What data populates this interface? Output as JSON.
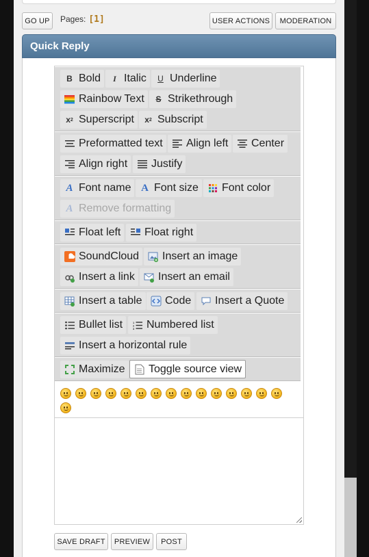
{
  "nav": {
    "go_up": "GO UP",
    "pages_label": "Pages:",
    "pages_value": "[1]",
    "user_actions": "USER ACTIONS",
    "moderation": "MODERATION"
  },
  "quick_reply": {
    "title": "Quick Reply"
  },
  "toolbar": {
    "bold": "Bold",
    "italic": "Italic",
    "underline": "Underline",
    "rainbow": "Rainbow Text",
    "strike": "Strikethrough",
    "superscript": "Superscript",
    "subscript": "Subscript",
    "preformatted": "Preformatted text",
    "align_left": "Align left",
    "center": "Center",
    "align_right": "Align right",
    "justify": "Justify",
    "font_name": "Font name",
    "font_size": "Font size",
    "font_color": "Font color",
    "remove_formatting": "Remove formatting",
    "float_left": "Float left",
    "float_right": "Float right",
    "soundcloud": "SoundCloud",
    "insert_image": "Insert an image",
    "insert_link": "Insert a link",
    "insert_email": "Insert an email",
    "insert_table": "Insert a table",
    "code": "Code",
    "quote": "Insert a Quote",
    "bullet": "Bullet list",
    "numbered": "Numbered list",
    "hr": "Insert a horizontal rule",
    "maximize": "Maximize",
    "source": "Toggle source view"
  },
  "actions": {
    "save_draft": "SAVE DRAFT",
    "preview": "PREVIEW",
    "post": "POST"
  },
  "colors": {
    "header_top": "#6f93b3",
    "header_bottom": "#4f7597",
    "pages_number": "#b07a1d",
    "toolbar_bg": "#dadada"
  }
}
